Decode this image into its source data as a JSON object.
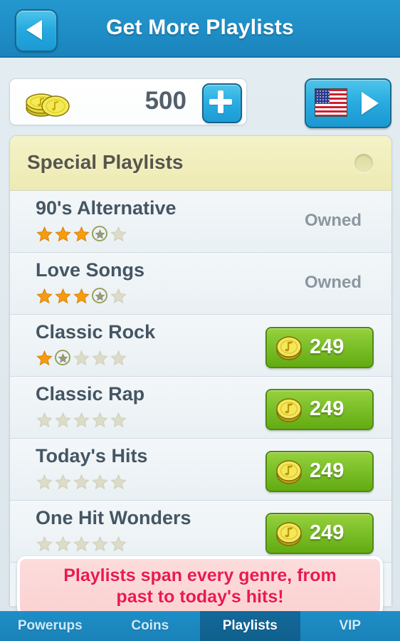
{
  "header": {
    "title": "Get More Playlists",
    "back_icon": "back-arrow-icon"
  },
  "currency": {
    "coin_icon": "coin-stack-icon",
    "amount": "500",
    "add_label": "+"
  },
  "language": {
    "flag_icon": "us-flag-icon",
    "next_icon": "play-arrow-icon"
  },
  "section": {
    "title": "Special Playlists",
    "indicator_icon": "circle-indicator-icon"
  },
  "list": {
    "owned_label": "Owned",
    "items": [
      {
        "title": "90's Alternative",
        "stars_filled": 3,
        "stars_progress": 1,
        "stars_total": 5,
        "status": "owned",
        "price": ""
      },
      {
        "title": "Love Songs",
        "stars_filled": 3,
        "stars_progress": 1,
        "stars_total": 5,
        "status": "owned",
        "price": ""
      },
      {
        "title": "Classic Rock",
        "stars_filled": 1,
        "stars_progress": 1,
        "stars_total": 5,
        "status": "purchasable",
        "price": "249"
      },
      {
        "title": "Classic Rap",
        "stars_filled": 0,
        "stars_progress": 0,
        "stars_total": 5,
        "status": "purchasable",
        "price": "249"
      },
      {
        "title": "Today's Hits",
        "stars_filled": 0,
        "stars_progress": 0,
        "stars_total": 5,
        "status": "purchasable",
        "price": "249"
      },
      {
        "title": "One Hit Wonders",
        "stars_filled": 0,
        "stars_progress": 0,
        "stars_total": 5,
        "status": "purchasable",
        "price": "249"
      }
    ]
  },
  "promo": {
    "line1": "Playlists span every genre, from",
    "line2": "past to today's hits!"
  },
  "tabs": [
    {
      "label": "Powerups",
      "active": false
    },
    {
      "label": "Coins",
      "active": false
    },
    {
      "label": "Playlists",
      "active": true
    },
    {
      "label": "VIP",
      "active": false
    }
  ],
  "colors": {
    "header_blue": "#1f8dc6",
    "accent_blue": "#27abe0",
    "section_yellow": "#f0ecb6",
    "price_green": "#7cc02a",
    "promo_pink": "#fbd2d2",
    "promo_text": "#ea1a4e",
    "star_gold": "#f79c10",
    "star_empty": "#dcdcc8",
    "title_slate": "#445663",
    "owned_gray": "#8b96a0"
  }
}
